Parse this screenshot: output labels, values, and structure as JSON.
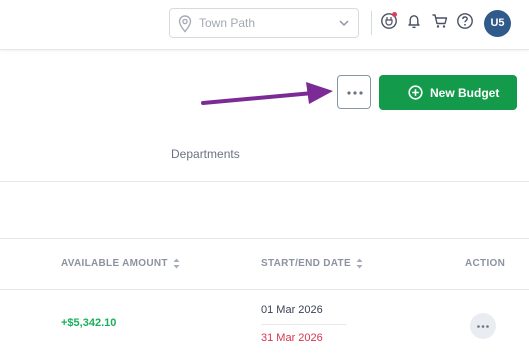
{
  "header": {
    "location_placeholder": "Town Path",
    "avatar_initials": "U5"
  },
  "toolbar": {
    "new_budget_label": "New Budget"
  },
  "filters": {
    "departments_label": "Departments"
  },
  "table": {
    "columns": [
      "AVAILABLE AMOUNT",
      "START/END DATE",
      "ACTION"
    ],
    "rows": [
      {
        "available_amount": "+$5,342.10",
        "start_date": "01 Mar 2026",
        "end_date": "31 Mar 2026"
      }
    ]
  },
  "colors": {
    "primary_green": "#149a4b",
    "positive_amount": "#18b05a",
    "end_date_red": "#d93450",
    "annotation_arrow": "#7b2a96",
    "avatar_bg": "#2f5a8a"
  }
}
